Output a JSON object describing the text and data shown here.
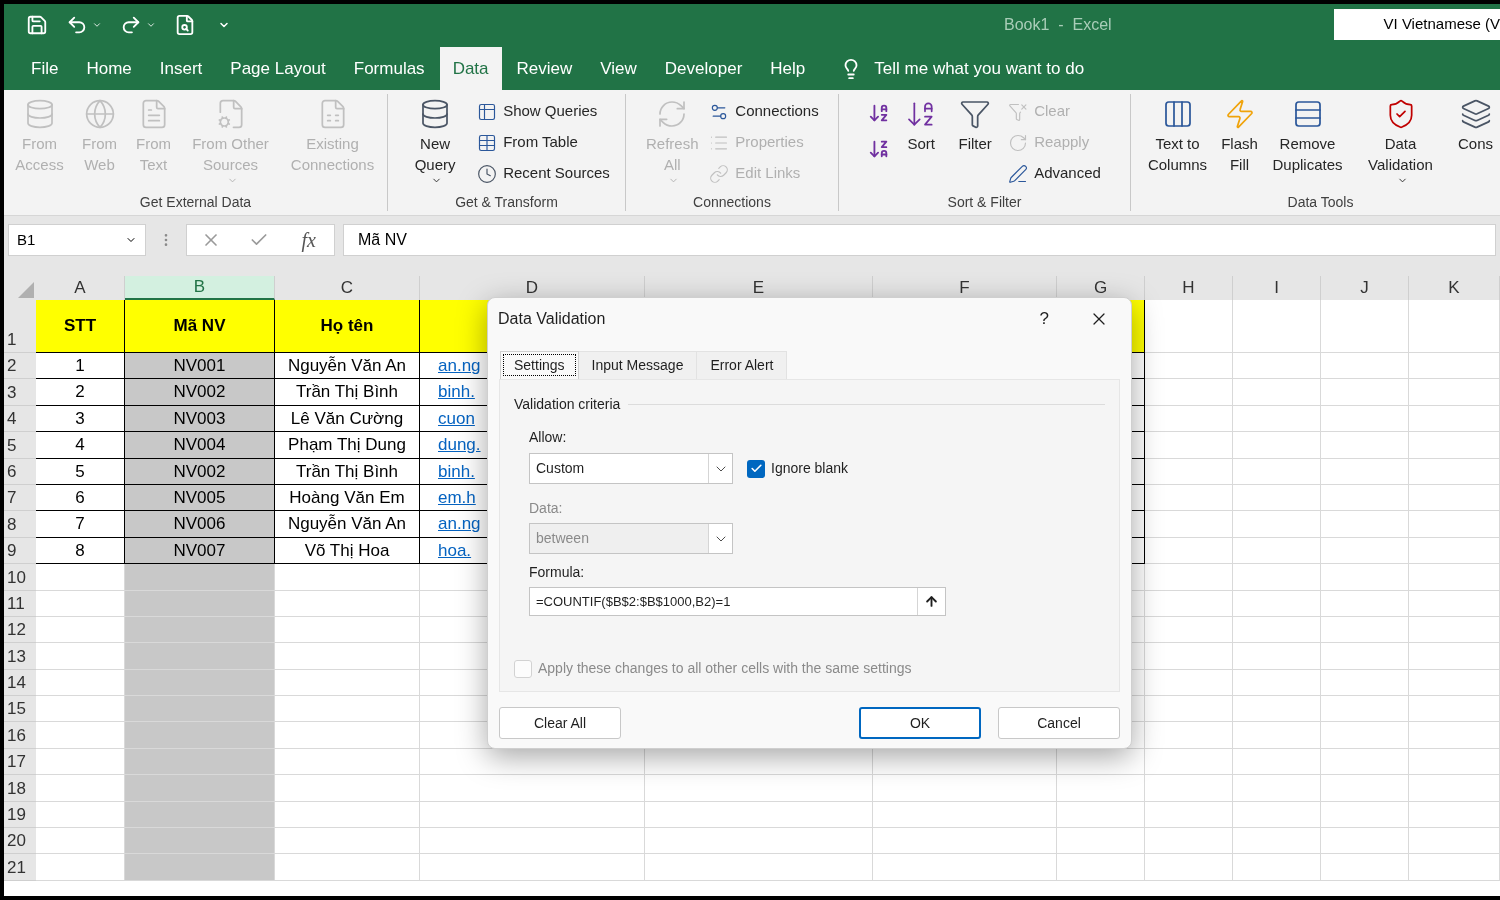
{
  "window": {
    "title": "Book1  -  Excel",
    "language": "VI  Vietnamese (V"
  },
  "quick_access": [
    {
      "kind": "save"
    },
    {
      "kind": "undo",
      "dropdown": true
    },
    {
      "kind": "redo",
      "dropdown": true
    },
    {
      "kind": "preview"
    },
    {
      "kind": "customize"
    }
  ],
  "tabs": [
    {
      "label": "File",
      "selected": false
    },
    {
      "label": "Home",
      "selected": false
    },
    {
      "label": "Insert",
      "selected": false
    },
    {
      "label": "Page Layout",
      "selected": false
    },
    {
      "label": "Formulas",
      "selected": false
    },
    {
      "label": "Data",
      "selected": true
    },
    {
      "label": "Review",
      "selected": false
    },
    {
      "label": "View",
      "selected": false
    },
    {
      "label": "Developer",
      "selected": false
    },
    {
      "label": "Help",
      "selected": false
    }
  ],
  "tell_me": {
    "placeholder": "Tell me what you want to do"
  },
  "ribbon": [
    {
      "label": "Get External Data",
      "items": [
        {
          "kind": "large",
          "label": "From Access",
          "disabled": true,
          "dropdown": false
        },
        {
          "kind": "large",
          "label": "From Web",
          "disabled": true,
          "dropdown": false
        },
        {
          "kind": "large",
          "label": "From Text",
          "disabled": true,
          "dropdown": false
        },
        {
          "kind": "large",
          "label": "From Other Sources",
          "disabled": true,
          "dropdown": true
        },
        {
          "kind": "large",
          "label": "Existing Connections",
          "disabled": true,
          "dropdown": false
        }
      ]
    },
    {
      "label": "Get & Transform",
      "items": [
        {
          "kind": "large",
          "label": "New Query",
          "disabled": false,
          "dropdown": true
        },
        {
          "kind": "stack",
          "items": [
            {
              "label": "Show Queries",
              "disabled": false
            },
            {
              "label": "From Table",
              "disabled": false
            },
            {
              "label": "Recent Sources",
              "disabled": false
            }
          ]
        }
      ]
    },
    {
      "label": "Connections",
      "items": [
        {
          "kind": "large",
          "label": "Refresh All",
          "disabled": true,
          "dropdown": true
        },
        {
          "kind": "stack",
          "items": [
            {
              "label": "Connections",
              "disabled": false
            },
            {
              "label": "Properties",
              "disabled": true
            },
            {
              "label": "Edit Links",
              "disabled": true
            }
          ]
        }
      ]
    },
    {
      "label": "Sort & Filter",
      "items": [
        {
          "kind": "sortpair"
        },
        {
          "kind": "large",
          "label": "Sort",
          "disabled": false,
          "dropdown": false
        },
        {
          "kind": "large",
          "label": "Filter",
          "disabled": false,
          "dropdown": false
        },
        {
          "kind": "stack",
          "items": [
            {
              "label": "Clear",
              "disabled": true
            },
            {
              "label": "Reapply",
              "disabled": true
            },
            {
              "label": "Advanced",
              "disabled": false
            }
          ]
        }
      ]
    },
    {
      "label": "Data Tools",
      "items": [
        {
          "kind": "large",
          "label": "Text to Columns",
          "disabled": false,
          "dropdown": false
        },
        {
          "kind": "large",
          "label": "Flash Fill",
          "disabled": false,
          "dropdown": false
        },
        {
          "kind": "large",
          "label": "Remove Duplicates",
          "disabled": false,
          "dropdown": false
        },
        {
          "kind": "large",
          "label": "Data Validation",
          "disabled": false,
          "dropdown": true
        },
        {
          "kind": "large",
          "label": "Cons",
          "disabled": false,
          "dropdown": false
        }
      ]
    }
  ],
  "formula_bar": {
    "name_box": "B1",
    "function_label": "fx",
    "content": "Mã NV"
  },
  "columns": [
    {
      "label": "A",
      "selected": false
    },
    {
      "label": "B",
      "selected": true
    },
    {
      "label": "C",
      "selected": false
    },
    {
      "label": "D",
      "selected": false
    },
    {
      "label": "E",
      "selected": false
    },
    {
      "label": "F",
      "selected": false
    },
    {
      "label": "G",
      "selected": false
    },
    {
      "label": "H",
      "selected": false
    },
    {
      "label": "I",
      "selected": false
    },
    {
      "label": "J",
      "selected": false
    },
    {
      "label": "K",
      "selected": false
    }
  ],
  "row_numbers": [
    "1",
    "2",
    "3",
    "4",
    "5",
    "6",
    "7",
    "8",
    "9",
    "10",
    "11",
    "12",
    "13",
    "14",
    "15",
    "16",
    "17",
    "18",
    "19",
    "20",
    "21"
  ],
  "header_row": [
    "STT",
    "Mã NV",
    "Họ tên"
  ],
  "rows": [
    {
      "stt": "1",
      "code": "NV001",
      "name": "Nguyễn Văn An",
      "email": "an.ng"
    },
    {
      "stt": "2",
      "code": "NV002",
      "name": "Trần Thị Bình",
      "email": "binh."
    },
    {
      "stt": "3",
      "code": "NV003",
      "name": "Lê Văn Cường",
      "email": "cuon"
    },
    {
      "stt": "4",
      "code": "NV004",
      "name": "Phạm Thị Dung",
      "email": "dung."
    },
    {
      "stt": "5",
      "code": "NV002",
      "name": "Trần Thị Bình",
      "email": "binh."
    },
    {
      "stt": "6",
      "code": "NV005",
      "name": "Hoàng Văn Em",
      "email": "em.h"
    },
    {
      "stt": "7",
      "code": "NV006",
      "name": "Nguyễn Văn An",
      "email": "an.ng"
    },
    {
      "stt": "8",
      "code": "NV007",
      "name": "Võ Thị Hoa",
      "email": "hoa."
    }
  ],
  "dialog": {
    "title": "Data Validation",
    "help": "?",
    "tabs": [
      {
        "label": "Settings",
        "selected": true
      },
      {
        "label": "Input Message",
        "selected": false
      },
      {
        "label": "Error Alert",
        "selected": false
      }
    ],
    "group_title": "Validation criteria",
    "allow": {
      "label": "Allow:",
      "value": "Custom"
    },
    "ignore_blank": {
      "label": "Ignore blank",
      "checked": true
    },
    "data": {
      "label": "Data:",
      "value": "between",
      "disabled": true
    },
    "formula": {
      "label": "Formula:",
      "value": "=COUNTIF($B$2:$B$1000,B2)=1"
    },
    "apply_all": {
      "label": "Apply these changes to all other cells with the same settings",
      "checked": false,
      "disabled": true
    },
    "buttons": [
      {
        "label": "Clear All",
        "kind": "left"
      },
      {
        "label": "OK",
        "kind": "default"
      },
      {
        "label": "Cancel",
        "kind": "normal"
      }
    ]
  }
}
